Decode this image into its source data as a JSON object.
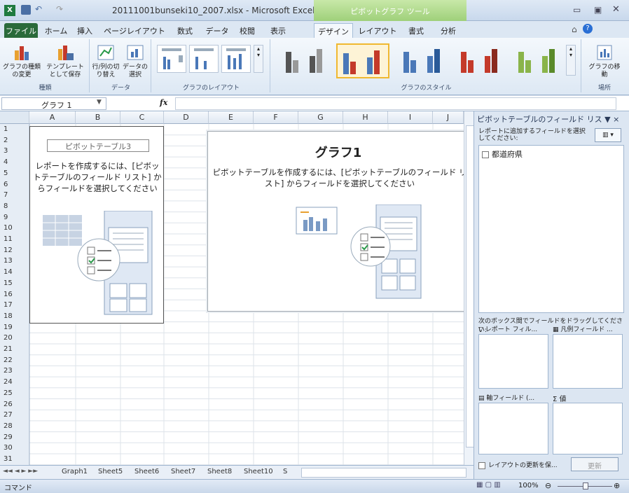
{
  "window": {
    "title": "20111001bunseki10_2007.xlsx - Microsoft Excel",
    "context_tab": "ピボットグラフ ツール"
  },
  "tabs": [
    "ファイル",
    "ホーム",
    "挿入",
    "ページレイアウト",
    "数式",
    "データ",
    "校閲",
    "表示",
    "デザイン",
    "レイアウト",
    "書式",
    "分析"
  ],
  "ribbon": {
    "type_group": {
      "label": "種類",
      "btn1": "グラフの種類の変更",
      "btn2": "テンプレートとして保存"
    },
    "data_group": {
      "label": "データ",
      "btn1": "行/列の切り替え",
      "btn2": "データの選択"
    },
    "layout_label": "グラフのレイアウト",
    "style_label": "グラフのスタイル",
    "location_group": {
      "label": "場所",
      "btn": "グラフの移動"
    }
  },
  "formula_bar": {
    "name_box": "グラフ 1",
    "fx": "fx"
  },
  "columns": [
    "A",
    "B",
    "C",
    "D",
    "E",
    "F",
    "G",
    "H",
    "I",
    "J"
  ],
  "rows": [
    "1",
    "2",
    "3",
    "4",
    "5",
    "6",
    "7",
    "8",
    "9",
    "10",
    "11",
    "12",
    "13",
    "14",
    "15",
    "16",
    "17",
    "18",
    "19",
    "20",
    "21",
    "22",
    "23",
    "24",
    "25",
    "26",
    "27",
    "28",
    "29",
    "30",
    "31"
  ],
  "pivot": {
    "name": "ピボットテーブル3",
    "message": "レポートを作成するには、[ピボットテーブルのフィールド リスト] からフィールドを選択してください"
  },
  "chart": {
    "title": "グラフ1",
    "message": "ピボットテーブルを作成するには、[ピボットテーブルのフィールド リスト] からフィールドを選択してください"
  },
  "field_panel": {
    "title": "ピボットテーブルのフィールド リス ▼ ×",
    "instruction": "レポートに追加するフィールドを選択してください:",
    "fields": [
      "都道府県"
    ],
    "drag_hint": "次のボックス間でフィールドをドラッグしてください:",
    "report_filter": "レポート フィル...",
    "legend_fields": "凡例フィールド ...",
    "axis_fields": "軸フィールド (...",
    "values": "値",
    "defer_label": "レイアウトの更新を保...",
    "update": "更新"
  },
  "sheet_tabs": [
    "Graph1",
    "Sheet5",
    "Sheet6",
    "Sheet7",
    "Sheet8",
    "Sheet10",
    "S"
  ],
  "status": {
    "mode": "コマンド",
    "zoom": "100%"
  }
}
